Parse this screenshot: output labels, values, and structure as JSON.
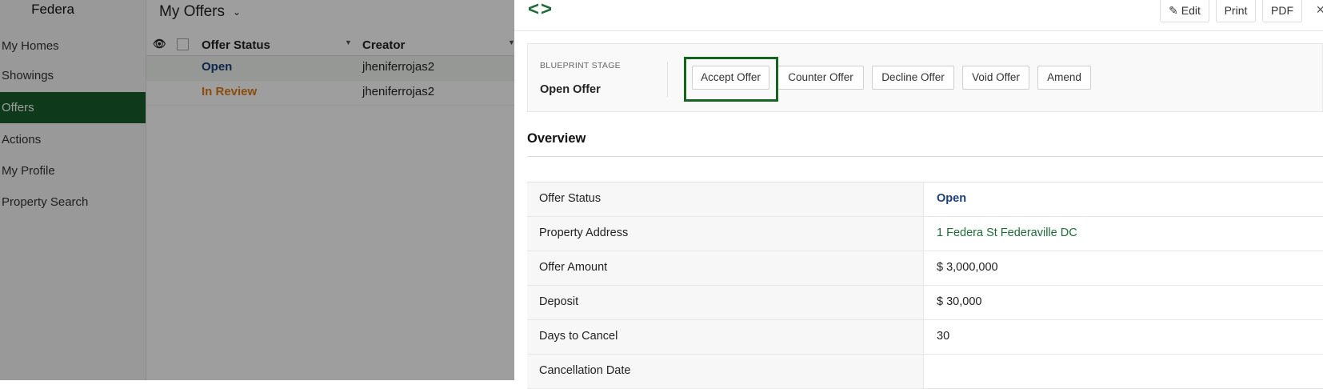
{
  "sidebar": {
    "brand": "Federa",
    "items": [
      {
        "label": "My Homes"
      },
      {
        "label": "Showings"
      },
      {
        "label": "Offers"
      },
      {
        "label": "Actions"
      },
      {
        "label": "My Profile"
      },
      {
        "label": "Property Search"
      }
    ],
    "active_item": "Offers"
  },
  "list": {
    "title": "My Offers",
    "title_chevron": "⌄",
    "columns": {
      "status": "Offer Status",
      "creator": "Creator"
    },
    "rows": [
      {
        "status": "Open",
        "creator": "jheniferrojas2"
      },
      {
        "status": "In Review",
        "creator": "jheniferrojas2"
      }
    ]
  },
  "panel": {
    "nav_arrows": "<>",
    "toolbar": {
      "edit": "Edit",
      "print": "Print",
      "pdf": "PDF",
      "close": "×"
    },
    "blueprint": {
      "label": "BLUEPRINT STAGE",
      "stage": "Open Offer",
      "actions": [
        "Accept Offer",
        "Counter Offer",
        "Decline Offer",
        "Void Offer",
        "Amend"
      ]
    },
    "overview": {
      "title": "Overview",
      "fields": [
        {
          "label": "Offer Status",
          "value": "Open"
        },
        {
          "label": "Property Address",
          "value": "1 Federa St Federaville DC"
        },
        {
          "label": "Offer Amount",
          "value": "$ 3,000,000"
        },
        {
          "label": "Deposit",
          "value": "$ 30,000"
        },
        {
          "label": "Days to Cancel",
          "value": "30"
        },
        {
          "label": "Cancellation Date",
          "value": ""
        }
      ]
    }
  },
  "colors": {
    "brand_green": "#185c2a",
    "status_open": "#1b3f7a",
    "status_review": "#e07a12",
    "link_green": "#1f6b38",
    "highlight": "#16631f"
  }
}
